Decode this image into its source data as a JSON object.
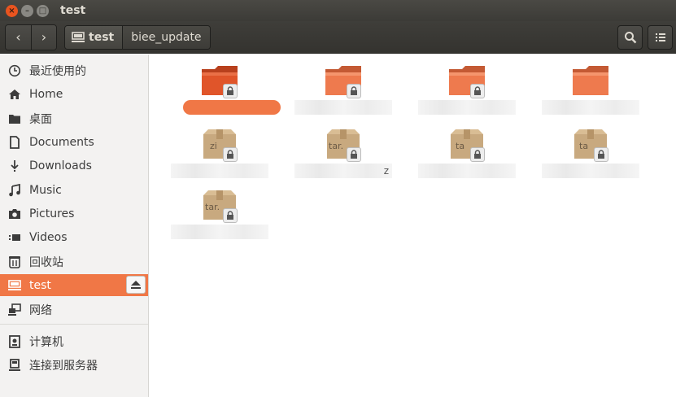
{
  "window": {
    "title": "test",
    "close_glyph": "×",
    "min_glyph": "–",
    "max_glyph": "□"
  },
  "toolbar": {
    "back_glyph": "‹",
    "forward_glyph": "›",
    "path": [
      {
        "label": "test",
        "icon": "drive-icon"
      },
      {
        "label": "biee_update"
      }
    ],
    "search_icon": "search-icon",
    "menu_icon": "list-menu-icon"
  },
  "sidebar": {
    "items": [
      {
        "label": "最近使用的",
        "icon": "clock-icon"
      },
      {
        "label": "Home",
        "icon": "home-icon"
      },
      {
        "label": "桌面",
        "icon": "desktop-folder-icon"
      },
      {
        "label": "Documents",
        "icon": "document-icon"
      },
      {
        "label": "Downloads",
        "icon": "download-icon"
      },
      {
        "label": "Music",
        "icon": "music-icon"
      },
      {
        "label": "Pictures",
        "icon": "camera-icon"
      },
      {
        "label": "Videos",
        "icon": "video-icon"
      },
      {
        "label": "回收站",
        "icon": "trash-icon"
      },
      {
        "label": "test",
        "icon": "drive-icon",
        "active": true,
        "eject": true
      },
      {
        "label": "网络",
        "icon": "network-icon"
      },
      {
        "label": "计算机",
        "icon": "computer-icon"
      },
      {
        "label": "连接到服务器",
        "icon": "server-icon"
      }
    ]
  },
  "files": [
    {
      "type": "folder",
      "label": "",
      "state": "selected"
    },
    {
      "type": "folder",
      "label": "",
      "state": "blurred"
    },
    {
      "type": "folder",
      "label": "",
      "state": "blurred"
    },
    {
      "type": "folder",
      "label": "",
      "state": "blurred"
    },
    {
      "type": "archive",
      "badge": "zi",
      "label": "",
      "state": "blurred"
    },
    {
      "type": "archive",
      "badge": "tar.",
      "label": "z",
      "state": "blurred"
    },
    {
      "type": "archive",
      "badge": "ta",
      "label": "",
      "state": "blurred"
    },
    {
      "type": "archive",
      "badge": "ta",
      "label": "",
      "state": "blurred"
    },
    {
      "type": "archive",
      "badge": "tar.",
      "label": "",
      "state": "blurred"
    }
  ],
  "colors": {
    "accent": "#f07746",
    "folder": "#e0552a",
    "archive": "#c8a97f",
    "titlebar": "#3c3b37"
  }
}
